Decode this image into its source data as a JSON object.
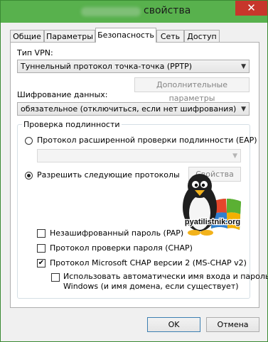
{
  "window": {
    "title": "свойства",
    "close_glyph": "✕"
  },
  "tabs": [
    {
      "label": "Общие"
    },
    {
      "label": "Параметры"
    },
    {
      "label": "Безопасность"
    },
    {
      "label": "Сеть"
    },
    {
      "label": "Доступ"
    }
  ],
  "security": {
    "vpn_type_label": "Тип VPN:",
    "vpn_type_value": "Туннельный протокол точка-точка (PPTP)",
    "advanced_button": "Дополнительные параметры",
    "encryption_label": "Шифрование данных:",
    "encryption_value": "обязательное (отключиться, если нет шифрования)",
    "auth_group_label": "Проверка подлинности",
    "eap_radio_label": "Протокол расширенной проверки подлинности (EAP)",
    "eap_combo_value": "",
    "allow_radio_label": "Разрешить следующие протоколы",
    "properties_button": "Свойства",
    "protocols": [
      {
        "label": "Незашифрованный пароль (PAP)",
        "checked": false
      },
      {
        "label": "Протокол проверки пароля (CHAP)",
        "checked": false
      },
      {
        "label": "Протокол Microsoft CHAP версии 2 (MS-CHAP v2)",
        "checked": true
      }
    ],
    "auto_logon_line1": "Использовать автоматически имя входа и пароль",
    "auto_logon_line2": "Windows (и имя домена, если существует)"
  },
  "watermark": {
    "text": "pyatilistnik.org"
  },
  "footer": {
    "ok_button": "OK",
    "cancel_button": "Отмена"
  },
  "colors": {
    "titlebar": "#58b14d",
    "close": "#c7362b",
    "accent_border": "#3c7fb1"
  },
  "icons": {
    "dropdown": "chevron-down-icon",
    "check": "check-icon"
  }
}
